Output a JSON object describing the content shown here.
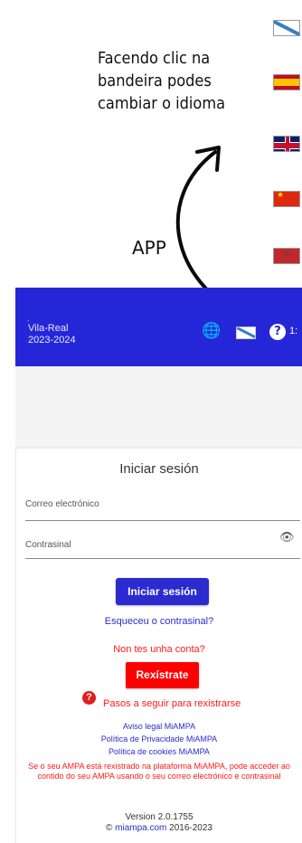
{
  "annotation": {
    "hint_text": "Facendo clic na bandeira podes cambiar o idioma",
    "app_label": "APP",
    "language_flags": [
      "galician-flag-icon",
      "spanish-flag-icon",
      "uk-flag-icon",
      "chinese-flag-icon",
      "moroccan-flag-icon"
    ]
  },
  "header": {
    "dot": ".",
    "school_name": "Vila-Real",
    "school_year": "2023-2024",
    "globe_icon": "🌐",
    "help_icon": "?",
    "extra": "1:",
    "color": "#2626d9"
  },
  "login": {
    "title": "Iniciar sesión",
    "email_label": "Correo electrónico",
    "password_label": "Contrasinal",
    "eye_icon": "👁",
    "login_button": "Iniciar sesión",
    "forgot_password": "Esqueceu o contrasinal?",
    "no_account": "Non tes unha conta?",
    "register_button": "Rexístrate",
    "help_icon": "?",
    "steps_link": "Pasos a seguir para rexistrarse",
    "legal_notice": "Aviso legal MiAMPA",
    "privacy_policy": "Política de Privacidade MiAMPA",
    "cookies_policy": "Política de cookies MiAMPA",
    "notice": "Se o seu AMPA está rexistrado na plataforma MiAMPA, pode acceder ao contido do seu AMPA usando o seu correo electrónico e contrasinal",
    "version": "Version 2.0.1755",
    "copyright_symbol": "©",
    "site": "miampa.com",
    "years": "2016-2023"
  },
  "colors": {
    "primary": "#2b2bd0",
    "accent_red": "#ff0000",
    "arrow_red": "#e8283c"
  }
}
